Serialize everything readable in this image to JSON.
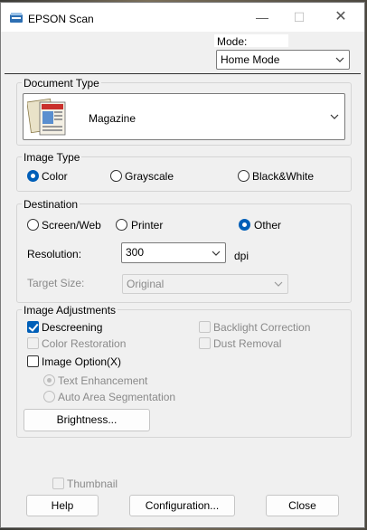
{
  "window": {
    "title": "EPSON Scan",
    "controls": {
      "minimize": "—",
      "maximize": "☐",
      "close": "✕"
    }
  },
  "mode": {
    "label": "Mode:",
    "selected": "Home Mode"
  },
  "document_type": {
    "title": "Document Type",
    "selected": "Magazine"
  },
  "image_type": {
    "title": "Image Type",
    "options": [
      {
        "label": "Color",
        "selected": true
      },
      {
        "label": "Grayscale",
        "selected": false
      },
      {
        "label": "Black&White",
        "selected": false
      }
    ]
  },
  "destination": {
    "title": "Destination",
    "options": [
      {
        "label": "Screen/Web",
        "selected": false
      },
      {
        "label": "Printer",
        "selected": false
      },
      {
        "label": "Other",
        "selected": true
      }
    ],
    "resolution_label": "Resolution:",
    "resolution_value": "300",
    "resolution_unit": "dpi",
    "target_size_label": "Target Size:",
    "target_size_value": "Original"
  },
  "adjustments": {
    "title": "Image Adjustments",
    "descreening": {
      "label": "Descreening",
      "checked": true
    },
    "backlight": {
      "label": "Backlight Correction",
      "checked": false,
      "enabled": false
    },
    "color_restoration": {
      "label": "Color Restoration",
      "checked": false,
      "enabled": false
    },
    "dust_removal": {
      "label": "Dust Removal",
      "checked": false,
      "enabled": false
    },
    "image_option": {
      "label": "Image Option(X)",
      "checked": false
    },
    "text_enhancement": {
      "label": "Text Enhancement",
      "selected": true,
      "enabled": false
    },
    "auto_area": {
      "label": "Auto Area Segmentation",
      "selected": false,
      "enabled": false
    },
    "brightness_button": "Brightness..."
  },
  "footer": {
    "thumbnail": {
      "label": "Thumbnail",
      "checked": false,
      "enabled": false
    },
    "help": "Help",
    "configuration": "Configuration...",
    "close": "Close"
  }
}
